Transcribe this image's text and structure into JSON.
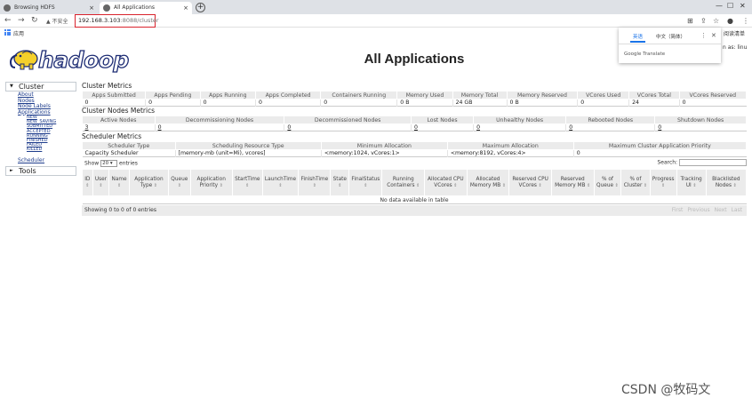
{
  "browser": {
    "tabs": [
      {
        "title": "Browsing HDFS",
        "active": false
      },
      {
        "title": "All Applications",
        "active": true
      }
    ],
    "new_tab": "+",
    "window_controls": [
      "—",
      "☐",
      "✕"
    ],
    "insecure_label": "不安全",
    "url_host": "192.168.3.103",
    "url_path": ":8088/cluster",
    "bookmarks_label": "应用",
    "reading_list": "阅读清单"
  },
  "translate_popup": {
    "tab_source": "英语",
    "tab_target": "中文（简体）",
    "provider": "Google Translate"
  },
  "header": {
    "logo_text": "hadoop",
    "title": "All Applications",
    "logged_in": "n as: linu"
  },
  "nav": {
    "cluster_label": "Cluster",
    "cluster_links": [
      "About",
      "Nodes",
      "Node Labels",
      "Applications"
    ],
    "app_states": [
      "NEW",
      "NEW_SAVING",
      "SUBMITTED",
      "ACCEPTED",
      "RUNNING",
      "FINISHED",
      "FAILED",
      "KILLED"
    ],
    "scheduler_label": "Scheduler",
    "tools_label": "Tools"
  },
  "cluster_metrics": {
    "title": "Cluster Metrics",
    "headers": [
      "Apps Submitted",
      "Apps Pending",
      "Apps Running",
      "Apps Completed",
      "Containers Running",
      "Memory Used",
      "Memory Total",
      "Memory Reserved",
      "VCores Used",
      "VCores Total",
      "VCores Reserved"
    ],
    "values": [
      "0",
      "0",
      "0",
      "0",
      "0",
      "0 B",
      "24 GB",
      "0 B",
      "0",
      "24",
      "0"
    ]
  },
  "node_metrics": {
    "title": "Cluster Nodes Metrics",
    "headers": [
      "Active Nodes",
      "Decommissioning Nodes",
      "Decommissioned Nodes",
      "Lost Nodes",
      "Unhealthy Nodes",
      "Rebooted Nodes",
      "Shutdown Nodes"
    ],
    "values": [
      "3",
      "0",
      "0",
      "0",
      "0",
      "0",
      "0"
    ]
  },
  "scheduler_metrics": {
    "title": "Scheduler Metrics",
    "headers": [
      "Scheduler Type",
      "Scheduling Resource Type",
      "Minimum Allocation",
      "Maximum Allocation",
      "Maximum Cluster Application Priority"
    ],
    "values": [
      "Capacity Scheduler",
      "[memory-mb (unit=Mi), vcores]",
      "<memory:1024, vCores:1>",
      "<memory:8192, vCores:4>",
      "0"
    ]
  },
  "apps_table": {
    "show_label": "Show",
    "length_value": "20",
    "entries_label": "entries",
    "search_label": "Search:",
    "columns": [
      "ID",
      "User",
      "Name",
      "Application Type",
      "Queue",
      "Application Priority",
      "StartTime",
      "LaunchTime",
      "FinishTime",
      "State",
      "FinalStatus",
      "Running Containers",
      "Allocated CPU VCores",
      "Allocated Memory MB",
      "Reserved CPU VCores",
      "Reserved Memory MB",
      "% of Queue",
      "% of Cluster",
      "Progress",
      "Tracking UI",
      "Blacklisted Nodes"
    ],
    "empty_message": "No data available in table",
    "info": "Showing 0 to 0 of 0 entries",
    "pager": [
      "First",
      "Previous",
      "Next",
      "Last"
    ]
  },
  "watermark": "CSDN @牧码文"
}
